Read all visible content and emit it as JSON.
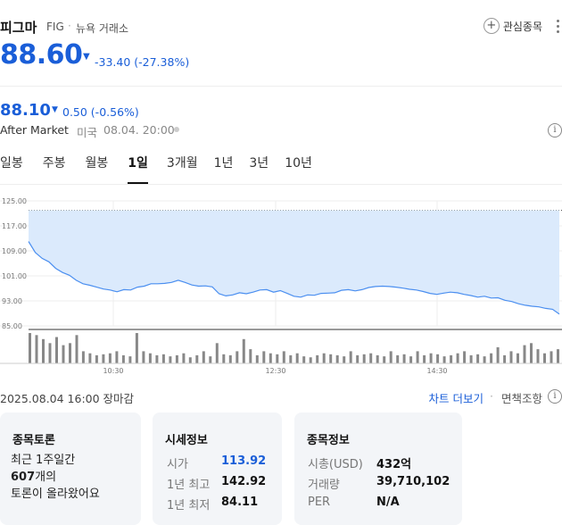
{
  "header": {
    "name": "피그마",
    "ticker": "FIG",
    "separator": "·",
    "exchange": "뉴욕 거래소",
    "watch_label": "관심종목"
  },
  "quote": {
    "price": "88.60",
    "change_arrow": "▼",
    "change": "-33.40 (-27.38%)"
  },
  "after_market": {
    "price": "88.10",
    "change_arrow": "▼",
    "change": "0.50 (-0.56%)",
    "label": "After Market",
    "region": "미국",
    "time": "08.04. 20:00"
  },
  "tabs": [
    {
      "label": "일봉",
      "active": false
    },
    {
      "label": "주봉",
      "active": false
    },
    {
      "label": "월봉",
      "active": false
    },
    {
      "label": "1일",
      "active": true
    },
    {
      "label": "3개월",
      "active": false
    },
    {
      "label": "1년",
      "active": false
    },
    {
      "label": "3년",
      "active": false
    },
    {
      "label": "10년",
      "active": false
    }
  ],
  "chart_data": {
    "type": "area",
    "y_ticks": [
      "125.00",
      "117.00",
      "109.00",
      "101.00",
      "93.00",
      "85.00"
    ],
    "ylim": [
      85,
      125
    ],
    "x_ticks": [
      "10:30",
      "12:30",
      "14:30"
    ],
    "reference_line": 122,
    "series": [
      {
        "values": [
          112,
          108.5,
          106.6,
          105.5,
          103.4,
          102.1,
          101.2,
          99.6,
          98.5,
          98,
          97.4,
          96.8,
          96.5,
          95.9,
          96.6,
          96.5,
          97.4,
          97.7,
          98.5,
          98.5,
          98.6,
          98.9,
          99.6,
          98.9,
          98.1,
          97.7,
          97.8,
          97.5,
          95.3,
          94.6,
          94.9,
          95.6,
          95.3,
          95.8,
          96.5,
          96.6,
          95.8,
          96.3,
          95.4,
          94.5,
          94.2,
          94.9,
          94.8,
          95.4,
          95.5,
          95.6,
          96.4,
          96.6,
          96.2,
          96.6,
          97.3,
          97.6,
          97.7,
          97.6,
          97.4,
          97.1,
          96.7,
          96.5,
          96,
          95.4,
          95.1,
          95.5,
          95.8,
          95.6,
          95.1,
          94.7,
          94.2,
          94.5,
          93.9,
          94,
          93.2,
          92.8,
          92.1,
          91.6,
          91.3,
          91.1,
          90.6,
          90.3,
          88.8
        ],
        "color": "#4b8ff0",
        "fill": "#dbeafc"
      }
    ],
    "volume": [
      30,
      28,
      24,
      20,
      26,
      18,
      20,
      28,
      12,
      10,
      8,
      9,
      10,
      12,
      8,
      7,
      30,
      12,
      10,
      8,
      9,
      7,
      8,
      10,
      6,
      8,
      12,
      7,
      20,
      9,
      8,
      12,
      24,
      14,
      8,
      12,
      10,
      9,
      12,
      8,
      10,
      7,
      6,
      8,
      10,
      9,
      8,
      7,
      12,
      8,
      9,
      10,
      8,
      7,
      12,
      8,
      9,
      7,
      12,
      8,
      10,
      9,
      7,
      8,
      10,
      12,
      8,
      9,
      7,
      10,
      16,
      8,
      12,
      10,
      18,
      20,
      14,
      10,
      12,
      14
    ]
  },
  "footer": {
    "date": "2025.08.04 16:00 장마감",
    "more_chart": "차트 더보기",
    "sep": "·",
    "disclaimer": "면책조항"
  },
  "cards": {
    "discussion": {
      "title": "종목토론",
      "line1": "최근 1주일간",
      "count": "607",
      "line2_suffix": "개의",
      "line3": "토론이 올라왔어요"
    },
    "market": {
      "title": "시세정보",
      "rows": [
        {
          "label": "시가",
          "value": "113.92"
        },
        {
          "label": "1년 최고",
          "value": "142.92"
        },
        {
          "label": "1년 최저",
          "value": "84.11"
        }
      ]
    },
    "company": {
      "title": "종목정보",
      "rows": [
        {
          "label": "시총(USD)",
          "value": "432억"
        },
        {
          "label": "거래량",
          "value": "39,710,102"
        },
        {
          "label": "PER",
          "value": "N/A"
        }
      ]
    }
  }
}
